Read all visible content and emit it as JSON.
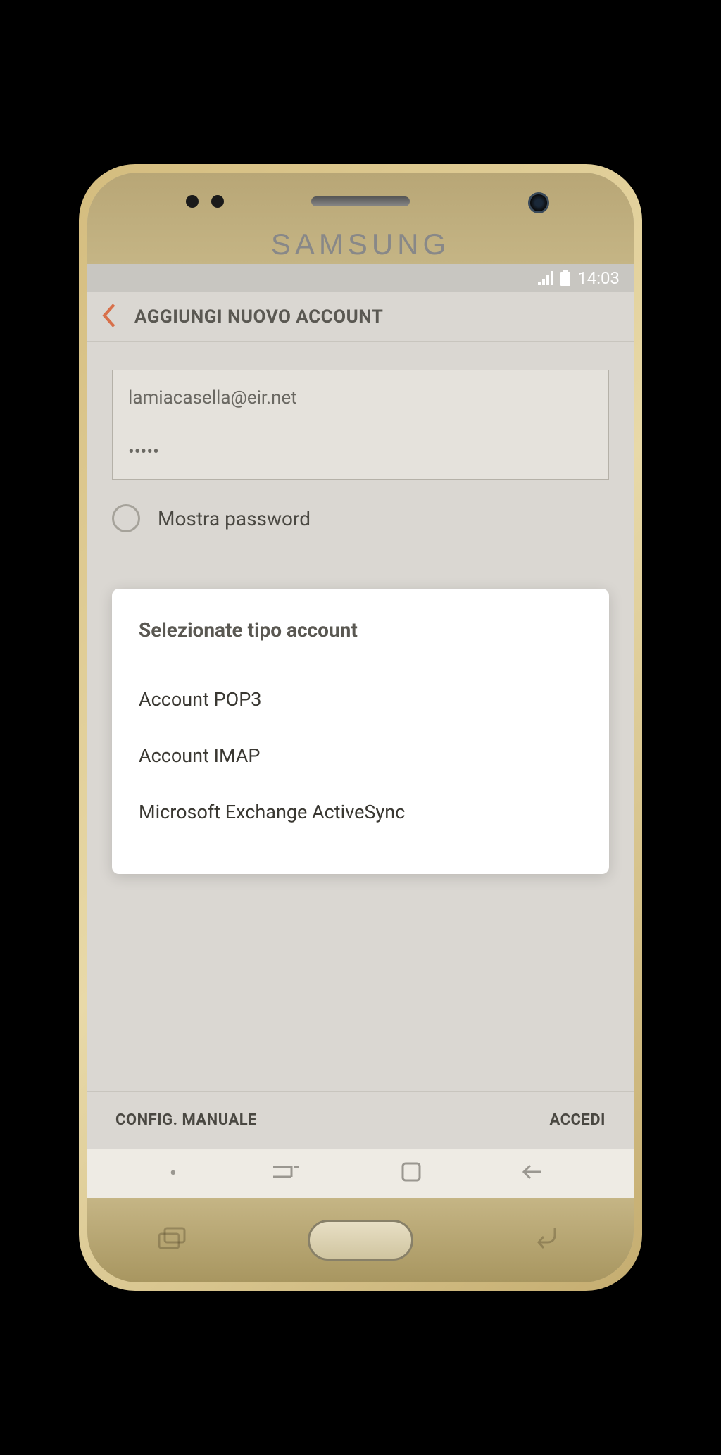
{
  "status_bar": {
    "time": "14:03"
  },
  "header": {
    "title": "AGGIUNGI NUOVO ACCOUNT"
  },
  "form": {
    "email_value": "lamiacasella@eir.net",
    "password_value": "•••••",
    "show_password_label": "Mostra password"
  },
  "dialog": {
    "title": "Selezionate tipo account",
    "options": [
      "Account POP3",
      "Account IMAP",
      "Microsoft Exchange ActiveSync"
    ]
  },
  "actions": {
    "manual_config": "CONFIG. MANUALE",
    "login": "ACCEDI"
  },
  "brand": "SAMSUNG"
}
